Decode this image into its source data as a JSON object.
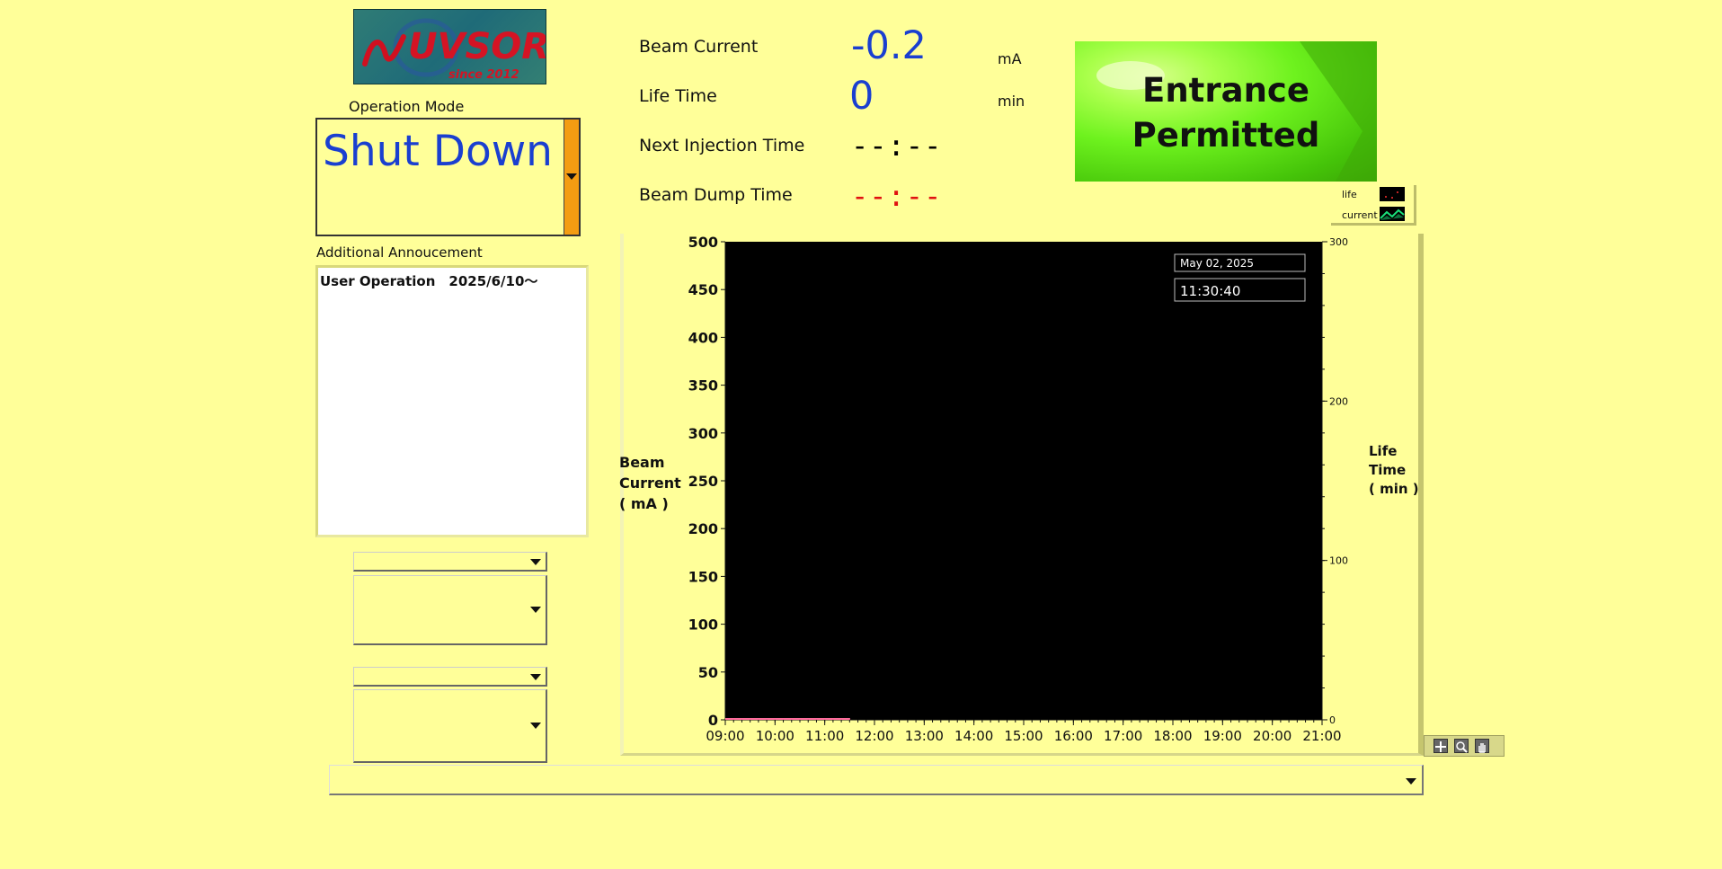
{
  "logo": {
    "wordmark": "UVSOR III",
    "tagline": "since 2012"
  },
  "operation_mode": {
    "label": "Operation Mode",
    "value": "Shut Down"
  },
  "announcement": {
    "label": "Additional Annoucement",
    "text": "User Operation　2025/6/10～"
  },
  "readouts": {
    "beam_current": {
      "label": "Beam Current",
      "value": "-0.2",
      "unit": "mA"
    },
    "life_time": {
      "label": "Life Time",
      "value": "0",
      "unit": "min"
    },
    "next_injection": {
      "label": "Next Injection Time",
      "value": "--:--",
      "color": "#000000"
    },
    "beam_dump": {
      "label": "Beam Dump Time",
      "value": "--:--",
      "color": "#e01010"
    }
  },
  "entrance": {
    "line1": "Entrance",
    "line2": "Permitted",
    "color": "#6ef21e"
  },
  "legend": {
    "items": [
      {
        "label": "life",
        "color": "#ff3030"
      },
      {
        "label": "current",
        "color": "#19e07a"
      }
    ]
  },
  "chart_data": {
    "type": "line",
    "title": "",
    "date_label": "May 02, 2025",
    "time_label": "11:30:40",
    "xlabel": "",
    "ylabel_left": [
      "Beam",
      "Current",
      "( mA )"
    ],
    "ylabel_right": [
      "Life",
      "Time",
      "( min )"
    ],
    "x_ticks": [
      "09:00",
      "10:00",
      "11:00",
      "12:00",
      "13:00",
      "14:00",
      "15:00",
      "16:00",
      "17:00",
      "18:00",
      "19:00",
      "20:00",
      "21:00"
    ],
    "y_left_ticks": [
      0,
      50,
      100,
      150,
      200,
      250,
      300,
      350,
      400,
      450,
      500
    ],
    "y_left_range": [
      0,
      500
    ],
    "y_right_ticks": [
      0,
      100,
      200,
      300
    ],
    "y_right_range": [
      0,
      300
    ],
    "x_range_hours": [
      9,
      21
    ],
    "series": [
      {
        "name": "current",
        "color": "#ff6b9d",
        "x_hours": [
          9.0,
          9.5,
          10.0,
          10.5,
          11.0,
          11.51
        ],
        "values": [
          0,
          0,
          0,
          0,
          0,
          0
        ]
      }
    ],
    "grid": false,
    "legend_position": "top-right"
  },
  "colors": {
    "background": "#ffff99",
    "accent_blue": "#1a3fd0",
    "mode_bar": "#f39c12",
    "plot_bg": "#000000"
  },
  "icons": {
    "dropdown": "chevron-down-icon",
    "graph_tools": [
      "cursor-mode-icon",
      "zoom-icon",
      "pan-hand-icon"
    ]
  }
}
